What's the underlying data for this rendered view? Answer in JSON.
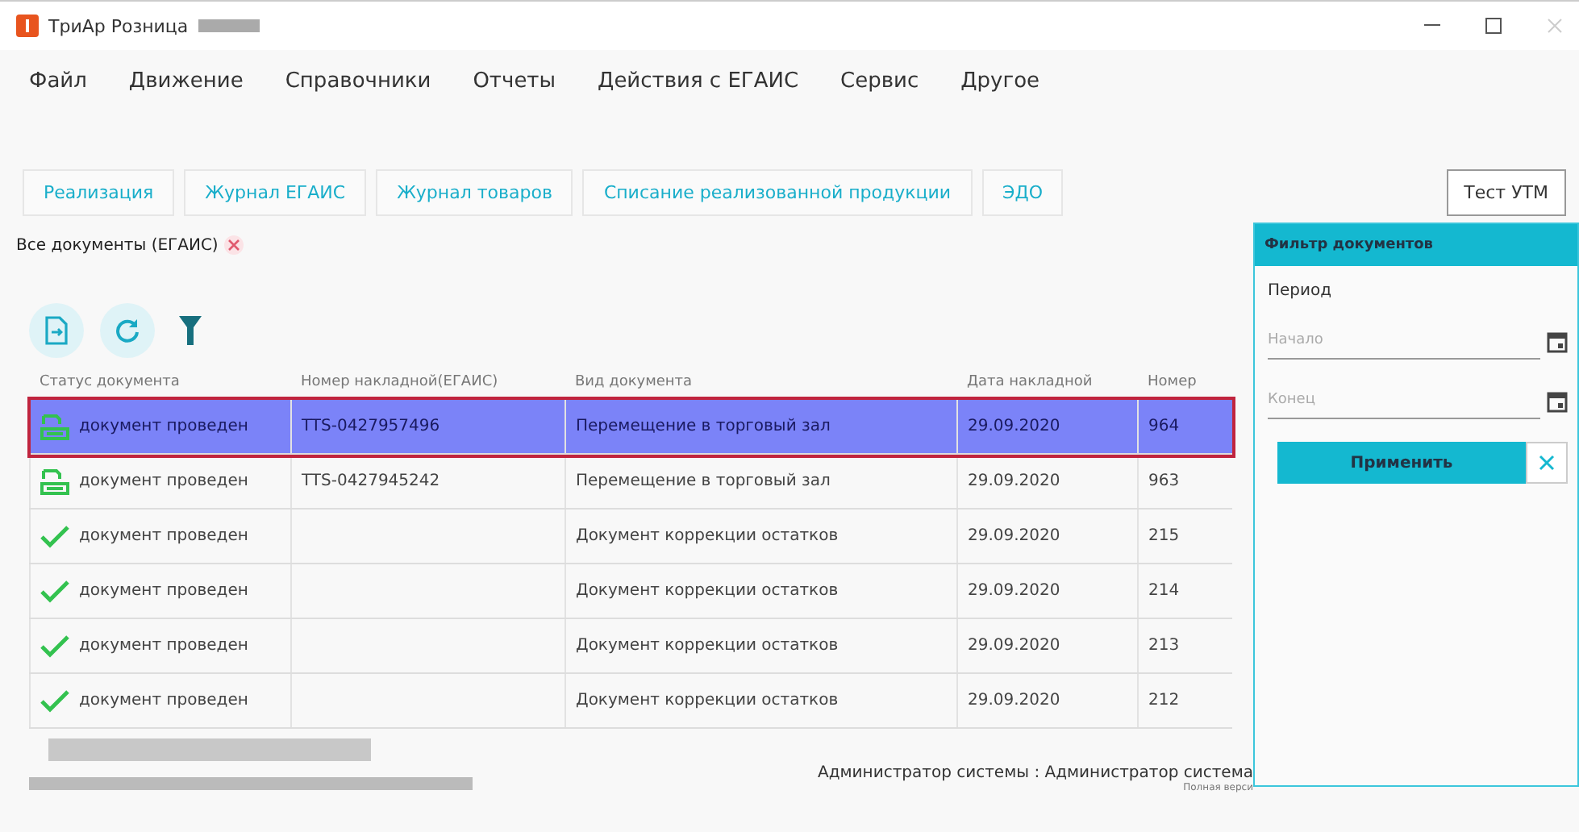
{
  "window": {
    "title": "ТриАр Розница"
  },
  "menu": [
    "Файл",
    "Движение",
    "Справочники",
    "Отчеты",
    "Действия с ЕГАИС",
    "Сервис",
    "Другое"
  ],
  "quick_buttons": [
    "Реализация",
    "Журнал ЕГАИС",
    "Журнал товаров",
    "Списание реализованной продукции",
    "ЭДО"
  ],
  "test_button": "Тест УТМ",
  "tabs": [
    {
      "label": "Все документы (ЕГАИС)",
      "selected": true
    }
  ],
  "table": {
    "columns": [
      "Статус документа",
      "Номер накладной(ЕГАИС)",
      "Вид документа",
      "Дата накладной",
      "Номер"
    ],
    "rows": [
      {
        "kind": "transfer",
        "selected": true,
        "cells": [
          "документ проведен",
          "TTS-0427957496",
          "Перемещение в торговый зал",
          "29.09.2020",
          "964"
        ]
      },
      {
        "kind": "transfer",
        "selected": false,
        "cells": [
          "документ проведен",
          "TTS-0427945242",
          "Перемещение в торговый зал",
          "29.09.2020",
          "963"
        ]
      },
      {
        "kind": "check",
        "selected": false,
        "cells": [
          "документ проведен",
          "",
          "Документ коррекции остатков",
          "29.09.2020",
          "215"
        ]
      },
      {
        "kind": "check",
        "selected": false,
        "cells": [
          "документ проведен",
          "",
          "Документ коррекции остатков",
          "29.09.2020",
          "214"
        ]
      },
      {
        "kind": "check",
        "selected": false,
        "cells": [
          "документ проведен",
          "",
          "Документ коррекции остатков",
          "29.09.2020",
          "213"
        ]
      },
      {
        "kind": "check",
        "selected": false,
        "cells": [
          "документ проведен",
          "",
          "Документ коррекции остатков",
          "29.09.2020",
          "212"
        ]
      }
    ]
  },
  "filter": {
    "title": "Фильтр документов",
    "period_label": "Период",
    "start": {
      "placeholder": "Начало"
    },
    "end": {
      "placeholder": "Конец"
    },
    "apply": "Применить"
  },
  "status_bar": {
    "user": "Администратор системы : Администратор система",
    "version": "Полная верси"
  }
}
